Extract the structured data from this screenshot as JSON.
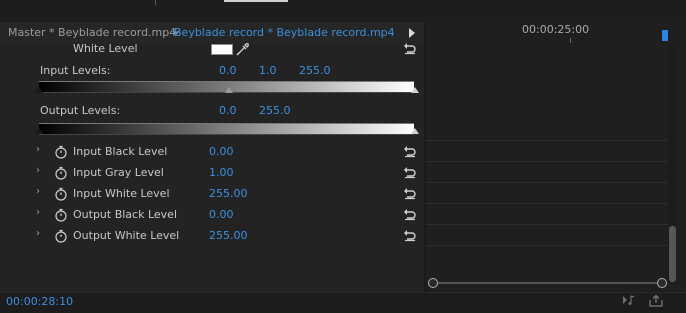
{
  "tabs": {
    "master_label": "Master * Beyblade record.mp4",
    "clip_label": "Beyblade record * Beyblade record.mp4"
  },
  "timeline": {
    "ruler_time": "00:00:25:00"
  },
  "effect": {
    "white_level": {
      "label": "White Level",
      "swatch_color": "#ffffff"
    },
    "input_levels": {
      "label": "Input Levels:",
      "black": "0.0",
      "gray": "1.0",
      "white": "255.0"
    },
    "output_levels": {
      "label": "Output Levels:",
      "black": "0.0",
      "white": "255.0"
    },
    "params": [
      {
        "label": "Input Black Level",
        "value": "0.00"
      },
      {
        "label": "Input Gray Level",
        "value": "1.00"
      },
      {
        "label": "Input White Level",
        "value": "255.00"
      },
      {
        "label": "Output Black Level",
        "value": "0.00"
      },
      {
        "label": "Output White Level",
        "value": "255.00"
      }
    ]
  },
  "status": {
    "timecode": "00:00:28:10"
  },
  "colors": {
    "accent": "#3d8fe0",
    "playhead": "#2f86e8"
  },
  "icons": [
    "eyedropper-icon",
    "reset-icon",
    "stopwatch-icon",
    "chevron-right-icon",
    "chevron-down-icon",
    "play-arrow-icon",
    "audio-icon",
    "export-icon"
  ]
}
